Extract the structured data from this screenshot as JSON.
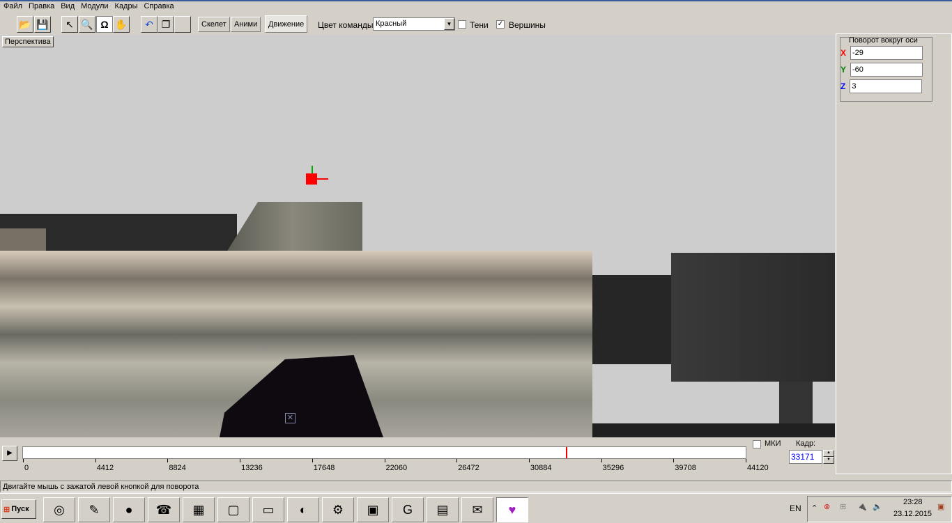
{
  "menu": [
    "Файл",
    "Правка",
    "Вид",
    "Модули",
    "Кадры",
    "Справка"
  ],
  "tabs": [
    "Скелет",
    "Аними",
    "Движение"
  ],
  "team_color_label": "Цвет команды:",
  "team_color_value": "Красный",
  "shadows_label": "Тени",
  "shadows_checked": false,
  "vertices_label": "Вершины",
  "vertices_checked": true,
  "view_button": "Перспектива",
  "rotation": {
    "title": "Поворот вокруг оси",
    "x_label": "X",
    "y_label": "Y",
    "z_label": "Z",
    "x": "-29",
    "y": "-60",
    "z": "3",
    "x_color": "#ff0000",
    "y_color": "#008000",
    "z_color": "#0000ff"
  },
  "timeline": {
    "ticks": [
      "0",
      "4412",
      "8824",
      "13236",
      "17648",
      "22060",
      "26472",
      "30884",
      "35296",
      "39708",
      "44120"
    ],
    "max": 44120,
    "current": 33171
  },
  "mki_label": "МКИ",
  "frame_label": "Кадр:",
  "frame_value": "33171",
  "status": "Двигайте мышь с зажатой левой кнопкой для поворота",
  "taskbar": {
    "start": "Пуск",
    "lang": "EN",
    "time": "23:28",
    "date": "23.12.2015"
  }
}
